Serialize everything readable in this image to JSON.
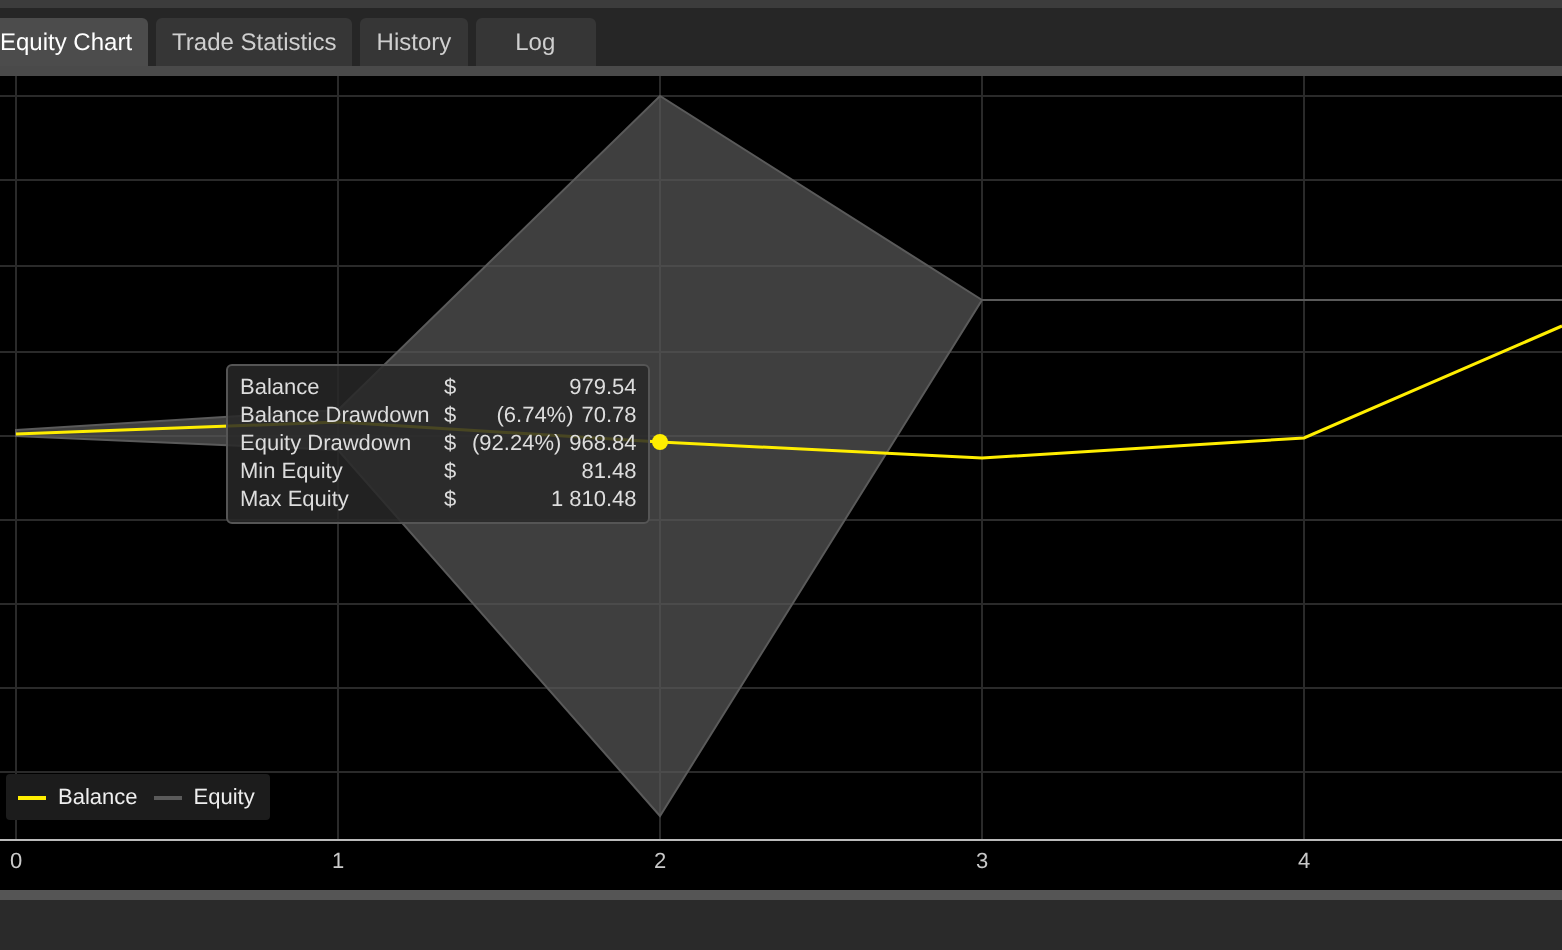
{
  "tabs": [
    {
      "label": "Equity Chart",
      "selected": true
    },
    {
      "label": "Trade Statistics",
      "selected": false
    },
    {
      "label": "History",
      "selected": false
    },
    {
      "label": "Log",
      "selected": false
    }
  ],
  "chart": {
    "x_labels": [
      "0",
      "1",
      "2",
      "3",
      "4"
    ],
    "tooltip": [
      {
        "label": "Balance",
        "currency": "$",
        "value": "979.54"
      },
      {
        "label": "Balance Drawdown",
        "currency": "$",
        "percent": "(6.74%)",
        "value": "70.78"
      },
      {
        "label": "Equity Drawdown",
        "currency": "$",
        "percent": "(92.24%)",
        "value": "968.84"
      },
      {
        "label": "Min Equity",
        "currency": "$",
        "value": "81.48"
      },
      {
        "label": "Max Equity",
        "currency": "$",
        "value": "1 810.48"
      }
    ],
    "legend": [
      {
        "label": "Balance",
        "color": "#ffee00"
      },
      {
        "label": "Equity",
        "color": "#5a5a5a"
      }
    ]
  }
}
